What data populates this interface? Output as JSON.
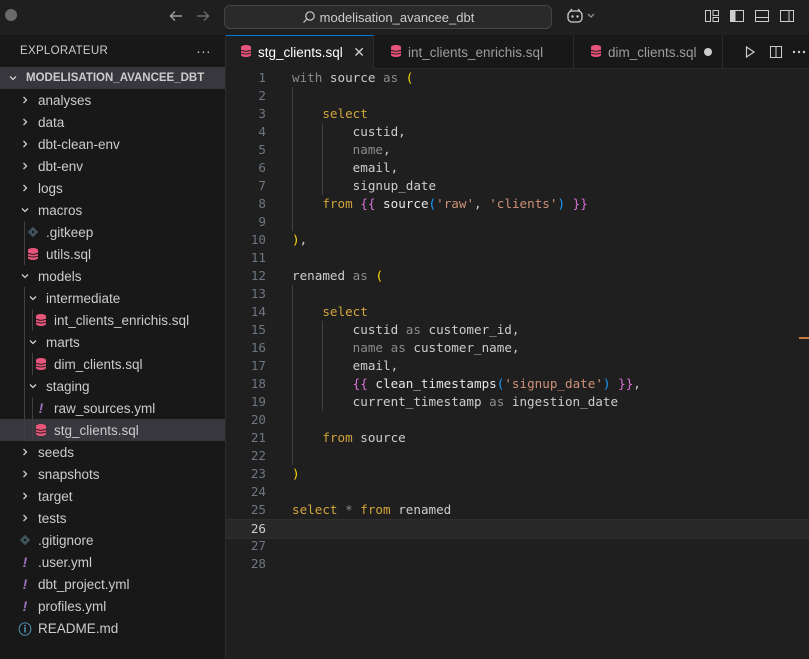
{
  "titlebar": {
    "search_text": "modelisation_avancee_dbt",
    "icons": [
      "back-arrow-icon",
      "forward-arrow-icon",
      "search-icon",
      "copilot-icon",
      "chevron-down-icon",
      "layout-customize-icon",
      "toggle-sidebar-icon",
      "toggle-panel-icon",
      "toggle-secondary-sidebar-icon"
    ]
  },
  "explorer": {
    "title": "EXPLORATEUR",
    "more": "···",
    "root": "MODELISATION_AVANCEE_DBT",
    "items": [
      {
        "label": "analyses",
        "depth": 0,
        "type": "folder",
        "expanded": false
      },
      {
        "label": "data",
        "depth": 0,
        "type": "folder",
        "expanded": false
      },
      {
        "label": "dbt-clean-env",
        "depth": 0,
        "type": "folder",
        "expanded": false
      },
      {
        "label": "dbt-env",
        "depth": 0,
        "type": "folder",
        "expanded": false
      },
      {
        "label": "logs",
        "depth": 0,
        "type": "folder",
        "expanded": false
      },
      {
        "label": "macros",
        "depth": 0,
        "type": "folder",
        "expanded": true
      },
      {
        "label": ".gitkeep",
        "depth": 1,
        "type": "git"
      },
      {
        "label": "utils.sql",
        "depth": 1,
        "type": "sql"
      },
      {
        "label": "models",
        "depth": 0,
        "type": "folder",
        "expanded": true
      },
      {
        "label": "intermediate",
        "depth": 1,
        "type": "folder",
        "expanded": true
      },
      {
        "label": "int_clients_enrichis.sql",
        "depth": 2,
        "type": "sql"
      },
      {
        "label": "marts",
        "depth": 1,
        "type": "folder",
        "expanded": true
      },
      {
        "label": "dim_clients.sql",
        "depth": 2,
        "type": "sql"
      },
      {
        "label": "staging",
        "depth": 1,
        "type": "folder",
        "expanded": true
      },
      {
        "label": "raw_sources.yml",
        "depth": 2,
        "type": "yml"
      },
      {
        "label": "stg_clients.sql",
        "depth": 2,
        "type": "sql",
        "selected": true
      },
      {
        "label": "seeds",
        "depth": 0,
        "type": "folder",
        "expanded": false
      },
      {
        "label": "snapshots",
        "depth": 0,
        "type": "folder",
        "expanded": false
      },
      {
        "label": "target",
        "depth": 0,
        "type": "folder",
        "expanded": false
      },
      {
        "label": "tests",
        "depth": 0,
        "type": "folder",
        "expanded": false
      },
      {
        "label": ".gitignore",
        "depth": 0,
        "type": "git"
      },
      {
        "label": ".user.yml",
        "depth": 0,
        "type": "yml"
      },
      {
        "label": "dbt_project.yml",
        "depth": 0,
        "type": "yml"
      },
      {
        "label": "profiles.yml",
        "depth": 0,
        "type": "yml"
      },
      {
        "label": "README.md",
        "depth": 0,
        "type": "info"
      }
    ]
  },
  "tabs": [
    {
      "label": "stg_clients.sql",
      "active": true,
      "state": "close"
    },
    {
      "label": "int_clients_enrichis.sql",
      "active": false,
      "state": "none"
    },
    {
      "label": "dim_clients.sql",
      "active": false,
      "state": "dirty"
    }
  ],
  "tab_actions": [
    "run-icon",
    "split-editor-icon",
    "more-actions-icon"
  ],
  "colors": {
    "sql_icon": "#e8557a",
    "accent": "#0078d4",
    "keyword": "#d1a53c",
    "string": "#ce9178"
  },
  "editor": {
    "current_line": 26,
    "lines": [
      [
        [
          "with",
          "kwd"
        ],
        [
          " source ",
          "p"
        ],
        [
          "as",
          "kwd"
        ],
        [
          " ",
          "p"
        ],
        [
          "(",
          "b1"
        ]
      ],
      [],
      [
        [
          "    ",
          "p"
        ],
        [
          "select",
          "kw"
        ]
      ],
      [
        [
          "        custid,",
          "p"
        ]
      ],
      [
        [
          "        ",
          "p"
        ],
        [
          "name",
          "dim"
        ],
        [
          ",",
          "p"
        ]
      ],
      [
        [
          "        email,",
          "p"
        ]
      ],
      [
        [
          "        signup_date",
          "p"
        ]
      ],
      [
        [
          "    ",
          "p"
        ],
        [
          "from",
          "kw"
        ],
        [
          " ",
          "p"
        ],
        [
          "{{",
          "b2"
        ],
        [
          " source",
          "fn"
        ],
        [
          "(",
          "b3"
        ],
        [
          "'raw'",
          "str"
        ],
        [
          ", ",
          "p"
        ],
        [
          "'clients'",
          "str"
        ],
        [
          ")",
          "b3"
        ],
        [
          " ",
          "p"
        ],
        [
          "}}",
          "b2"
        ]
      ],
      [],
      [
        [
          ")",
          "b1"
        ],
        [
          ",",
          "p"
        ]
      ],
      [],
      [
        [
          "renamed ",
          "p"
        ],
        [
          "as",
          "kwd"
        ],
        [
          " ",
          "p"
        ],
        [
          "(",
          "b1"
        ]
      ],
      [],
      [
        [
          "    ",
          "p"
        ],
        [
          "select",
          "kw"
        ]
      ],
      [
        [
          "        custid ",
          "p"
        ],
        [
          "as",
          "kwd"
        ],
        [
          " customer_id,",
          "p"
        ]
      ],
      [
        [
          "        ",
          "p"
        ],
        [
          "name",
          "dim"
        ],
        [
          " ",
          "p"
        ],
        [
          "as",
          "kwd"
        ],
        [
          " customer_name,",
          "p"
        ]
      ],
      [
        [
          "        email,",
          "p"
        ]
      ],
      [
        [
          "        ",
          "p"
        ],
        [
          "{{",
          "b2"
        ],
        [
          " clean_timestamps",
          "fn"
        ],
        [
          "(",
          "b3"
        ],
        [
          "'signup_date'",
          "str"
        ],
        [
          ")",
          "b3"
        ],
        [
          " ",
          "p"
        ],
        [
          "}}",
          "b2"
        ],
        [
          ",",
          "p"
        ]
      ],
      [
        [
          "        current_timestamp ",
          "p"
        ],
        [
          "as",
          "kwd"
        ],
        [
          " ingestion_date",
          "p"
        ]
      ],
      [],
      [
        [
          "    ",
          "p"
        ],
        [
          "from",
          "kw"
        ],
        [
          " source",
          "p"
        ]
      ],
      [],
      [
        [
          ")",
          "b1"
        ]
      ],
      [],
      [
        [
          "select ",
          "kw"
        ],
        [
          "*",
          "dim"
        ],
        [
          " ",
          "p"
        ],
        [
          "from",
          "kw"
        ],
        [
          " renamed",
          "p"
        ]
      ],
      [],
      [],
      []
    ]
  }
}
